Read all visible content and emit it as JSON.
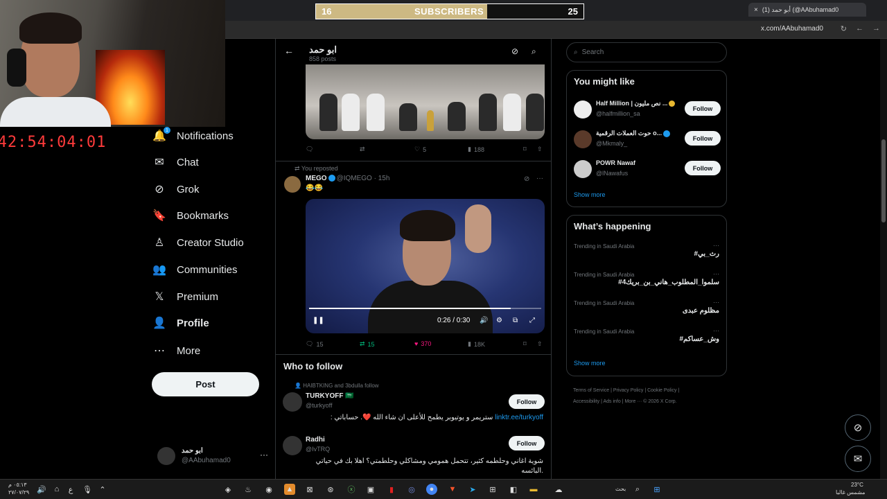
{
  "browser": {
    "tab_title": "(1) أبو حمد (@AAbuhamad0",
    "url": "x.com/AAbuhamad0",
    "new_tab": "+",
    "close_tab": "×"
  },
  "overlay": {
    "subscribers_current": "16",
    "subscribers_label": "SUBSCRIBERS",
    "subscribers_goal": "25",
    "progress": 0.64,
    "timer": "42:54:04:01"
  },
  "nav": {
    "items": [
      {
        "label": "Notifications",
        "icon": "bell-icon",
        "glyph": "🔔"
      },
      {
        "label": "Chat",
        "icon": "mail-icon",
        "glyph": "✉"
      },
      {
        "label": "Grok",
        "icon": "grok-icon",
        "glyph": "⊘"
      },
      {
        "label": "Bookmarks",
        "icon": "bookmark-icon",
        "glyph": "🔖"
      },
      {
        "label": "Creator Studio",
        "icon": "creator-icon",
        "glyph": "♙"
      },
      {
        "label": "Communities",
        "icon": "communities-icon",
        "glyph": "👥"
      },
      {
        "label": "Premium",
        "icon": "x-logo-icon",
        "glyph": "𝕏"
      },
      {
        "label": "Profile",
        "icon": "person-icon",
        "glyph": "👤"
      },
      {
        "label": "More",
        "icon": "more-circle-icon",
        "glyph": "⋯"
      }
    ],
    "notification_badge": "1",
    "post_label": "Post",
    "account_name": "ابو حمد",
    "account_handle": "@AAbuhamad0",
    "account_more": "···"
  },
  "profile_header": {
    "name": "ابو حمد",
    "post_count": "858 posts",
    "back_glyph": "←"
  },
  "tweet1_actions": {
    "replies": "",
    "reposts": "",
    "likes": "5",
    "views": "188"
  },
  "tweet2": {
    "repost_label": "You reposted",
    "author": "MEGO",
    "handle": "@IQMEGO · 15h",
    "text": "😂😂",
    "video_time": "0:26 / 0:30",
    "video_progress": 0.87,
    "replies": "15",
    "reposts": "15",
    "likes": "370",
    "views": "18K",
    "like_color": "#f91880",
    "repost_color": "#00ba7c"
  },
  "who_to_follow": {
    "title": "Who to follow",
    "context": "HAIBTKING and 3bdulla follow",
    "users": [
      {
        "name": "TURKYOFF 🇸🇦",
        "handle": "@turkyoff",
        "bio_link": "linktr.ee/turkyoff",
        "bio": " : ستريمر و يوتيوبر يطمح للأعلى ان شاء الله ❤️. حساباتي",
        "follow": "Follow"
      },
      {
        "name": "Radhi",
        "handle": "@IvTRQ",
        "bio_link": "",
        "bio": "شوية اغاني وحلطمه كثير، تتحمل همومي ومشاكلي وحلطمتي؟ اهلا بك في حياتي البائسه.",
        "follow": "Follow"
      }
    ]
  },
  "right": {
    "search_placeholder": "Search",
    "you_might_like": "You might like",
    "suggestions": [
      {
        "name": "Half Million | نص مليون ...",
        "handle": "@halfmillion_sa",
        "follow": "Follow",
        "badge": "gold"
      },
      {
        "name": "حوت العملات الرقمية o...",
        "handle": "@Mkmaly_",
        "follow": "Follow",
        "badge": "blue"
      },
      {
        "name": "POWR Nawaf",
        "handle": "@lNawafus",
        "follow": "Follow",
        "badge": ""
      }
    ],
    "show_more": "Show more",
    "whats_happening": "What’s happening",
    "trends": [
      {
        "context": "Trending in Saudi Arabia",
        "title": "#رث_بي"
      },
      {
        "context": "Trending in Saudi Arabia",
        "title": "#سلموا_المطلوب_هاني_بن_بريك4"
      },
      {
        "context": "Trending in Saudi Arabia",
        "title": "مظلوم عبدى"
      },
      {
        "context": "Trending in Saudi Arabia",
        "title": "#وش_عساكم"
      }
    ],
    "footer_line1": "Terms of Service  |  Privacy Policy  |  Cookie Policy  |",
    "footer_line2": "Accessibility  |  Ads info  |  More ···  © 2026 X Corp."
  },
  "taskbar": {
    "clock_time": "٠٥:١٣ م",
    "clock_date": "٢٧/٠٧/٢٩",
    "search_label": "بحث",
    "weather_temp": "23°C",
    "weather_desc": "مشمس غالبا",
    "lang": "ع"
  }
}
